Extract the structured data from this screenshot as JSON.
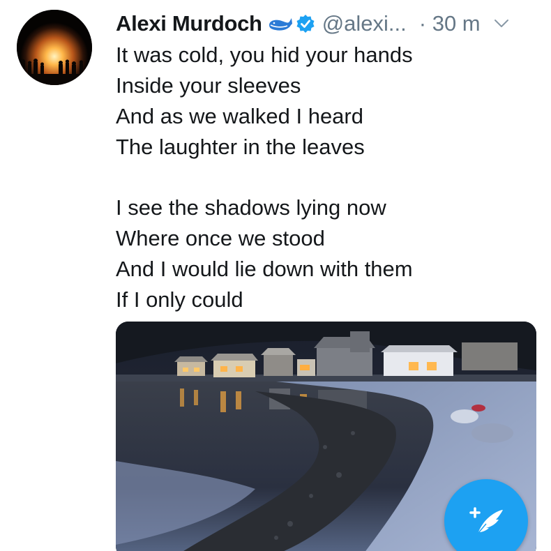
{
  "tweet": {
    "author_name": "Alexi Murdoch",
    "handle": "@alexi...",
    "timestamp": "· 30 m",
    "author_badges": [
      "whale-icon",
      "verified-badge-icon"
    ],
    "lines": [
      "It was cold, you hid your hands",
      "Inside your sleeves",
      "And as we walked I heard",
      "The laughter in the leaves",
      "",
      "I see the shadows lying now",
      "Where once we stood",
      "And I would lie down with them",
      "If I only could"
    ],
    "media": {
      "type": "photo"
    }
  },
  "compose_button": {
    "icon": "compose-feather-plus-icon"
  },
  "colors": {
    "accent": "#1da1f2",
    "secondary_text": "#657786",
    "primary_text": "#14171a"
  }
}
